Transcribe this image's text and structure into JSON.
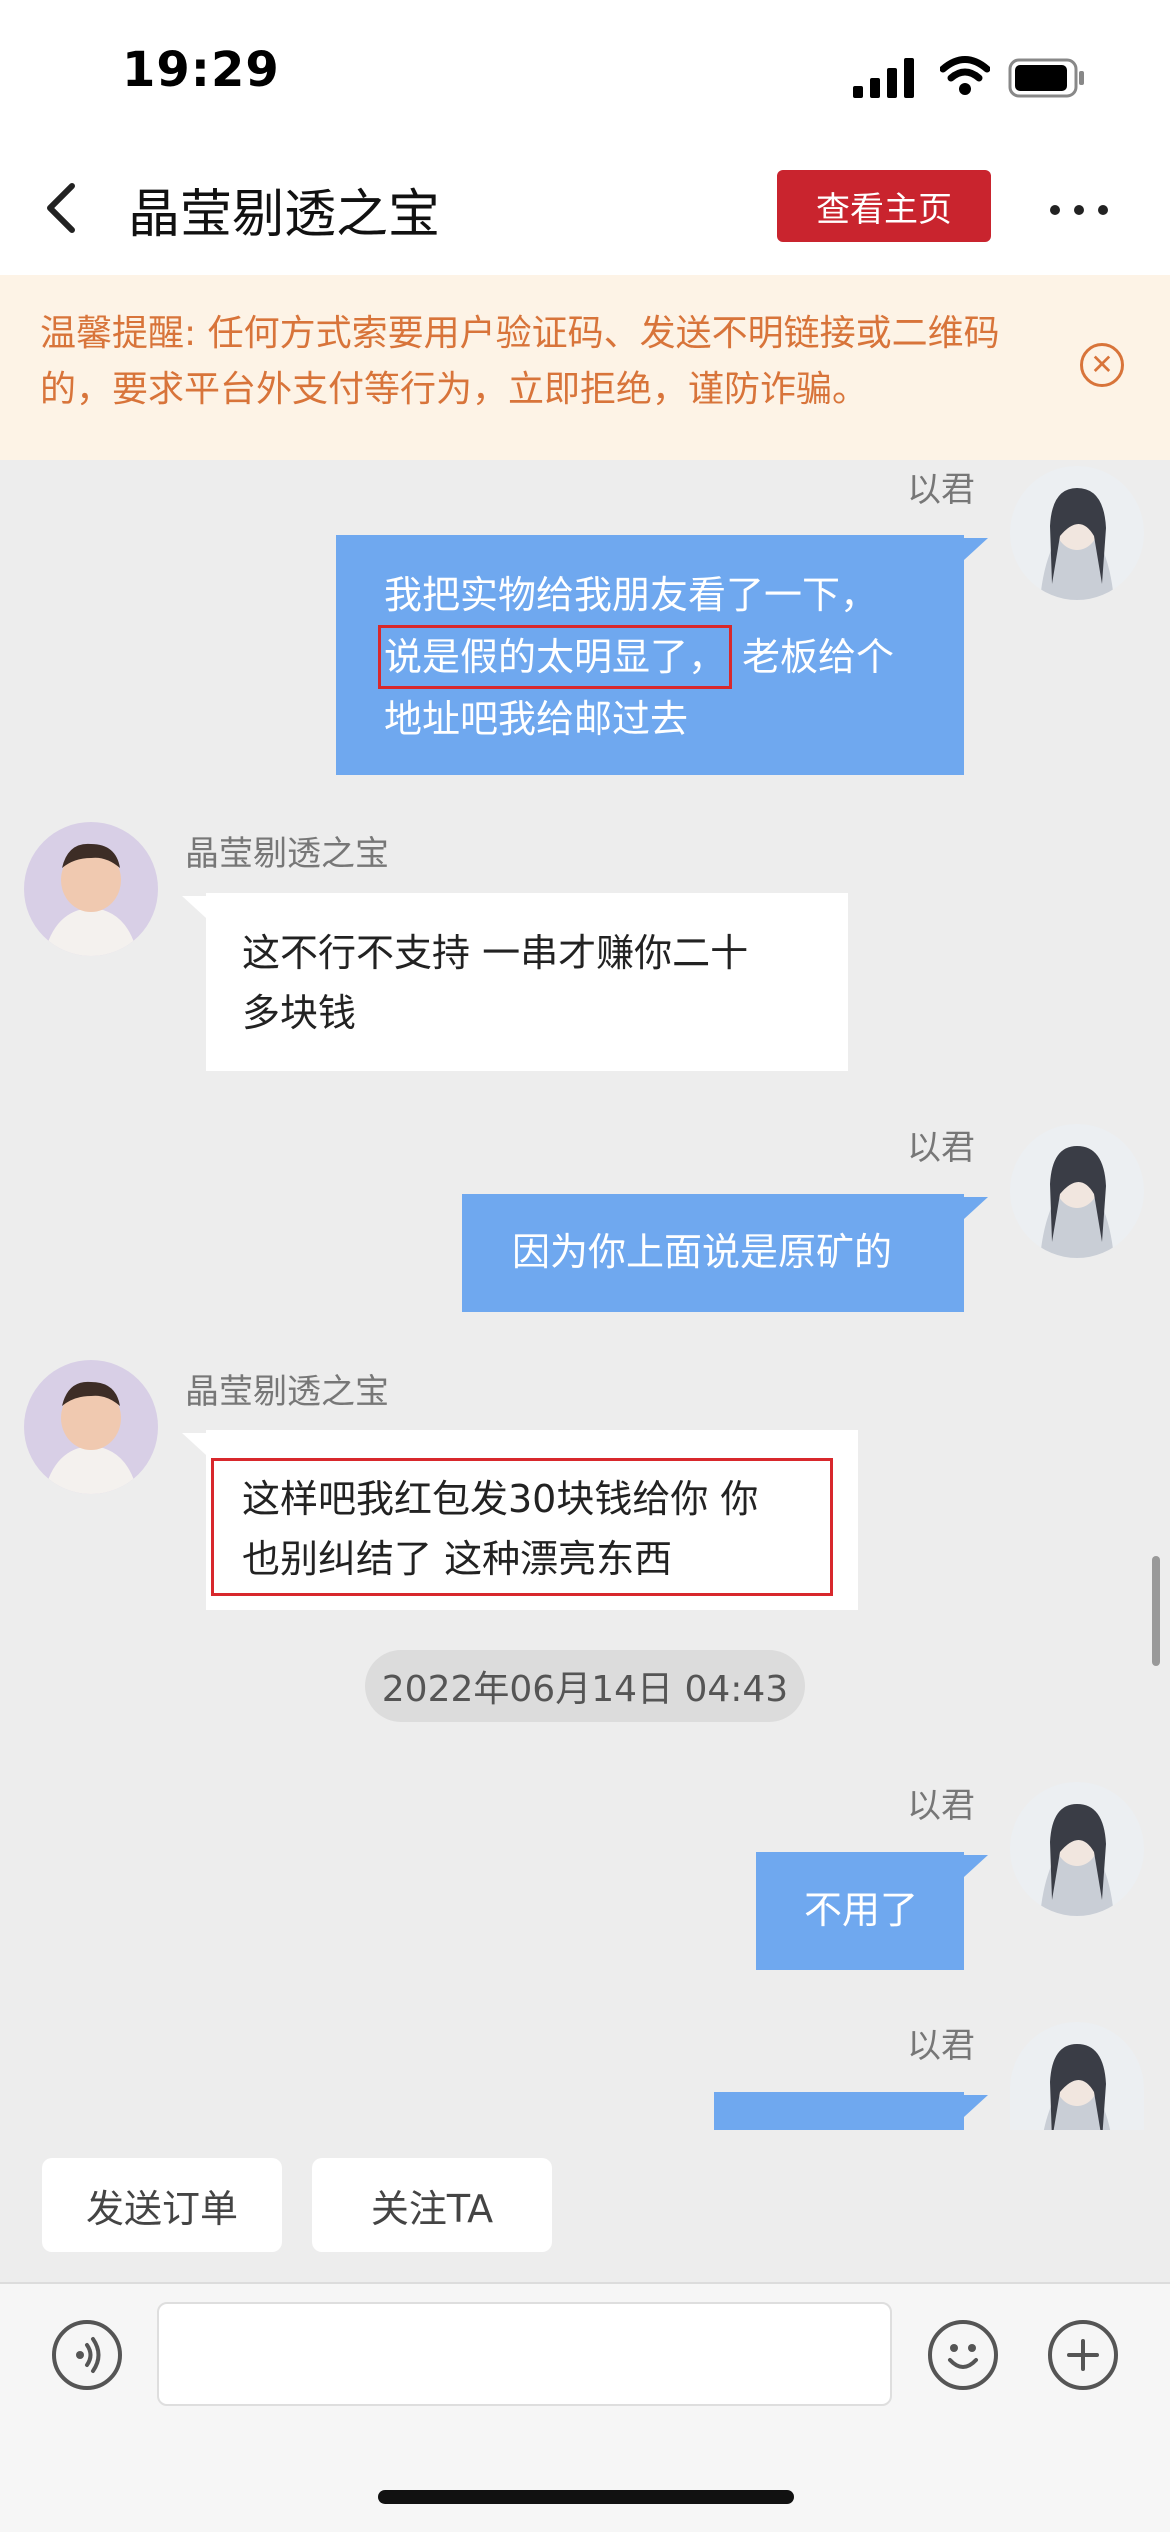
{
  "status_bar": {
    "time": "19:29"
  },
  "header": {
    "title": "晶莹剔透之宝",
    "homepage_button": "查看主页"
  },
  "notice": {
    "text": "温馨提醒: 任何方式索要用户验证码、发送不明链接或二维码的，要求平台外支付等行为，立即拒绝，谨防诈骗。"
  },
  "chat": {
    "me_name": "以君",
    "them_name": "晶莹剔透之宝",
    "msg1": {
      "line1": "我把实物给我朋友看了一下，",
      "highlight": "说是假的太明显了，",
      "rest": "老板给个",
      "line3": "地址吧我给邮过去"
    },
    "msg2": {
      "line1": "这不行不支持 一串才赚你二十",
      "line2": "多块钱"
    },
    "msg3": {
      "text": "因为你上面说是原矿的"
    },
    "msg4": {
      "line1": "这样吧我红包发30块钱给你 你",
      "line2": "也别纠结了 这种漂亮东西"
    },
    "timestamp": "2022年06月14日 04:43",
    "msg5": {
      "text": "不用了"
    }
  },
  "quick_actions": {
    "send_order": "发送订单",
    "follow": "关注TA"
  },
  "colors": {
    "accent_red": "#c9242e",
    "bubble_blue": "#6fa8ef",
    "notice_orange": "#d8743a"
  }
}
